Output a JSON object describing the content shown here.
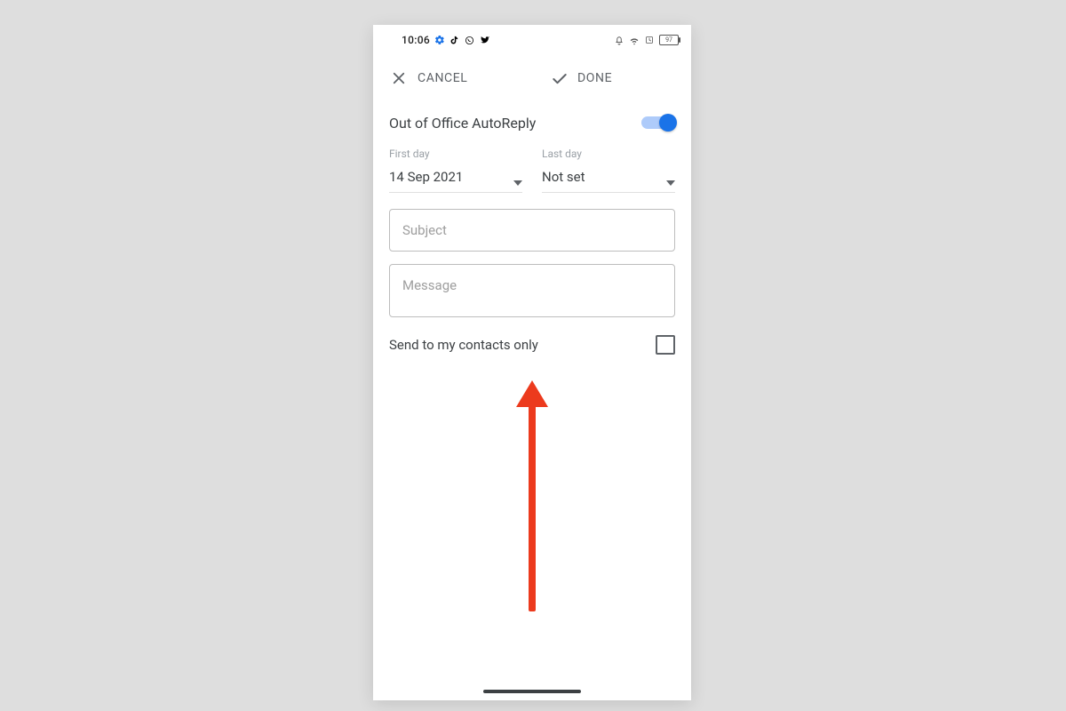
{
  "status": {
    "time": "10:06",
    "battery": "97"
  },
  "appbar": {
    "cancel_label": "CANCEL",
    "done_label": "DONE"
  },
  "toggle": {
    "label": "Out of Office AutoReply",
    "on": true
  },
  "dates": {
    "first": {
      "label": "First day",
      "value": "14 Sep 2021"
    },
    "last": {
      "label": "Last day",
      "value": "Not set"
    }
  },
  "fields": {
    "subject_placeholder": "Subject",
    "message_placeholder": "Message"
  },
  "checkbox": {
    "label": "Send to my contacts only",
    "checked": false
  },
  "annotation": {
    "color": "#ec3a1d"
  }
}
